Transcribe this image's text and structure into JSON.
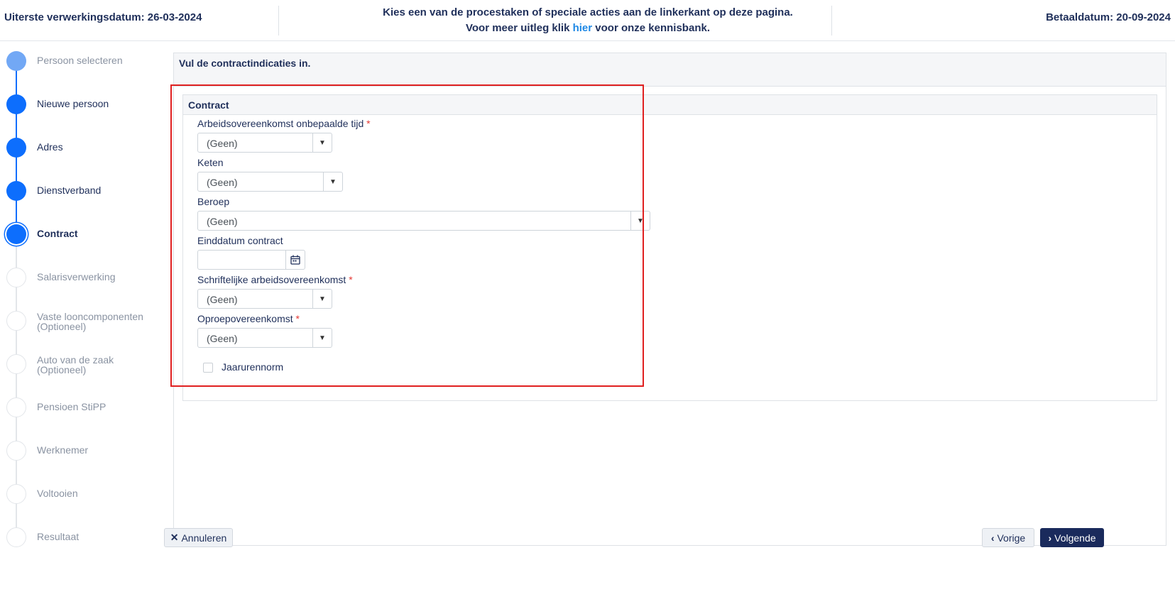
{
  "header": {
    "left": "Uiterste verwerkingsdatum: 26-03-2024",
    "center_line1": "Kies een van de procestaken of speciale acties aan de linkerkant op deze pagina.",
    "center_line2_pre": "Voor meer uitleg klik",
    "center_link": "hier",
    "center_line2_post": "voor onze kennisbank.",
    "right": "Betaaldatum: 20-09-2024"
  },
  "steps": [
    {
      "label": "Persoon selecteren",
      "state": "done"
    },
    {
      "label": "Nieuwe persoon",
      "state": "done"
    },
    {
      "label": "Adres",
      "state": "done"
    },
    {
      "label": "Dienstverband",
      "state": "done"
    },
    {
      "label": "Contract",
      "state": "current"
    },
    {
      "label": "Salarisverwerking",
      "state": "todo"
    },
    {
      "label": "Vaste looncomponenten",
      "sub": "(Optioneel)",
      "state": "todo"
    },
    {
      "label": "Auto van de zaak",
      "sub": "(Optioneel)",
      "state": "todo"
    },
    {
      "label": "Pensioen StiPP",
      "state": "todo"
    },
    {
      "label": "Werknemer",
      "state": "todo"
    },
    {
      "label": "Voltooien",
      "state": "todo"
    },
    {
      "label": "Resultaat",
      "state": "todo"
    }
  ],
  "panel": {
    "title": "Vul de contractindicaties in.",
    "card_title": "Contract",
    "fields": {
      "onbepaalde_tijd": {
        "label": "Arbeidsovereenkomst onbepaalde tijd",
        "required": "*",
        "value": "(Geen)"
      },
      "keten": {
        "label": "Keten",
        "value": "(Geen)"
      },
      "beroep": {
        "label": "Beroep",
        "value": "(Geen)"
      },
      "einddatum": {
        "label": "Einddatum contract",
        "value": ""
      },
      "schriftelijk": {
        "label": "Schriftelijke arbeidsovereenkomst",
        "required": "*",
        "value": "(Geen)"
      },
      "oproep": {
        "label": "Oproepovereenkomst",
        "required": "*",
        "value": "(Geen)"
      },
      "jaarurennorm": {
        "label": "Jaarurennorm"
      }
    }
  },
  "buttons": {
    "cancel": "Annuleren",
    "prev": "Vorige",
    "next": "Volgende"
  },
  "icons": {
    "cancel": "close-icon",
    "prev": "chevron-left-icon",
    "next": "chevron-right-icon",
    "dropdown": "caret-down-icon",
    "date": "calendar-icon"
  },
  "colors": {
    "primary": "#0d6efd",
    "navy": "#1a2a5c",
    "link": "#1e88e5",
    "required": "#e53935",
    "highlight": "#e02020"
  }
}
